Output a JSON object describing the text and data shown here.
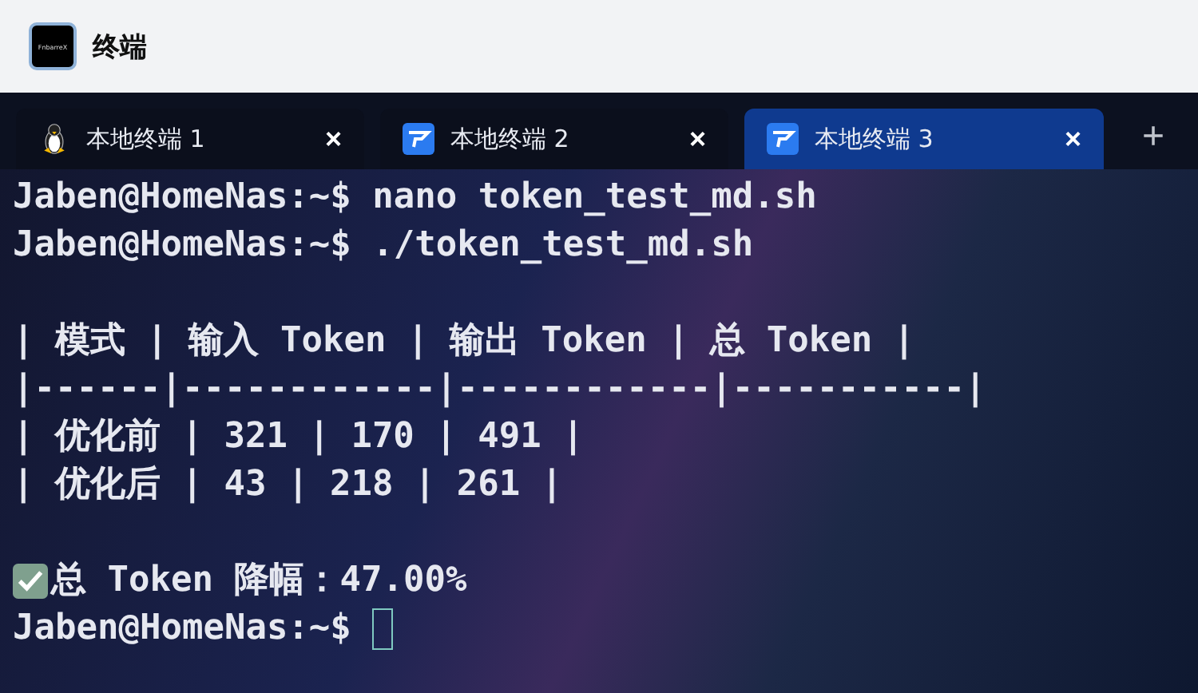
{
  "window": {
    "title": "终端",
    "app_icon_label": "FnbarreX"
  },
  "tabs": [
    {
      "label": "本地终端 1",
      "kind": "linux",
      "selected": false,
      "close": "×"
    },
    {
      "label": "本地终端 2",
      "kind": "app",
      "selected": false,
      "close": "×"
    },
    {
      "label": "本地终端 3",
      "kind": "app",
      "selected": true,
      "close": "×"
    }
  ],
  "new_tab": "+",
  "terminal": {
    "lines": [
      {
        "kind": "prompt",
        "prompt": "Jaben@HomeNas:~$",
        "command": "nano token_test_md.sh"
      },
      {
        "kind": "prompt",
        "prompt": "Jaben@HomeNas:~$",
        "command": "./token_test_md.sh"
      },
      {
        "kind": "blank"
      },
      {
        "kind": "output",
        "text": "| 模式 | 输入 Token | 输出 Token | 总 Token |"
      },
      {
        "kind": "output",
        "text": "|------|------------|------------|-----------|"
      },
      {
        "kind": "output",
        "text": "| 优化前 | 321 | 170 | 491 |"
      },
      {
        "kind": "output",
        "text": "| 优化后 | 43 | 218 | 261 |"
      },
      {
        "kind": "blank"
      },
      {
        "kind": "success",
        "text": "总 Token 降幅：47.00%"
      },
      {
        "kind": "prompt",
        "prompt": "Jaben@HomeNas:~$",
        "cursor": true
      }
    ]
  }
}
